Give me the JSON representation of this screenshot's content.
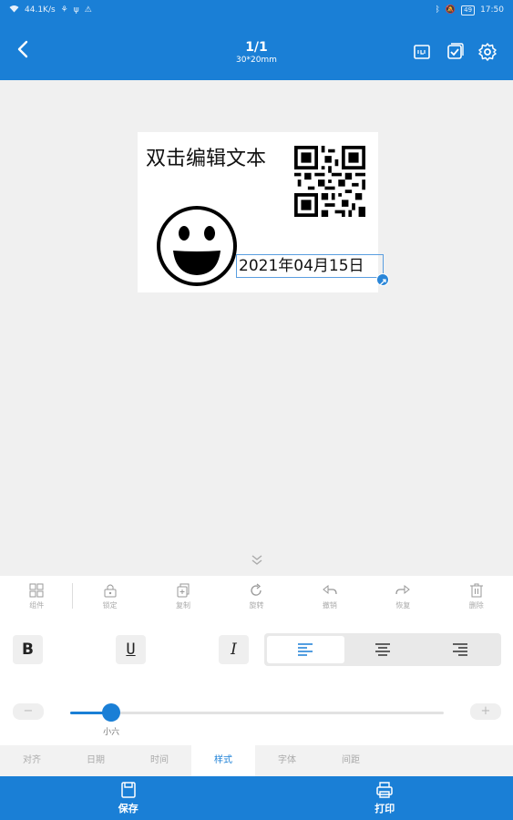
{
  "status_bar": {
    "speed": "44.1K/s",
    "battery": "49",
    "time": "17:50"
  },
  "header": {
    "title": "1/1",
    "subtitle": "30*20mm"
  },
  "label": {
    "text": "双击编辑文本",
    "date": "2021年04月15日"
  },
  "toolbar": {
    "items": [
      {
        "label": "组件",
        "icon": "grid-icon"
      },
      {
        "label": "锁定",
        "icon": "lock-icon"
      },
      {
        "label": "复制",
        "icon": "copy-icon"
      },
      {
        "label": "旋转",
        "icon": "rotate-icon"
      },
      {
        "label": "撤销",
        "icon": "undo-icon"
      },
      {
        "label": "恢复",
        "icon": "redo-icon"
      },
      {
        "label": "删除",
        "icon": "trash-icon"
      }
    ]
  },
  "style_panel": {
    "bold": "B",
    "underline": "U",
    "italic": "I",
    "alignment_selected": "left",
    "minus": "−",
    "plus": "+",
    "font_size_label": "小六",
    "font_size_level": 0.11
  },
  "tabs": [
    {
      "label": "对齐",
      "active": false
    },
    {
      "label": "日期",
      "active": false
    },
    {
      "label": "时间",
      "active": false
    },
    {
      "label": "样式",
      "active": true
    },
    {
      "label": "字体",
      "active": false
    },
    {
      "label": "间距",
      "active": false
    }
  ],
  "bottom_bar": {
    "save": "保存",
    "print": "打印"
  },
  "colors": {
    "accent": "#1a7fd6"
  }
}
